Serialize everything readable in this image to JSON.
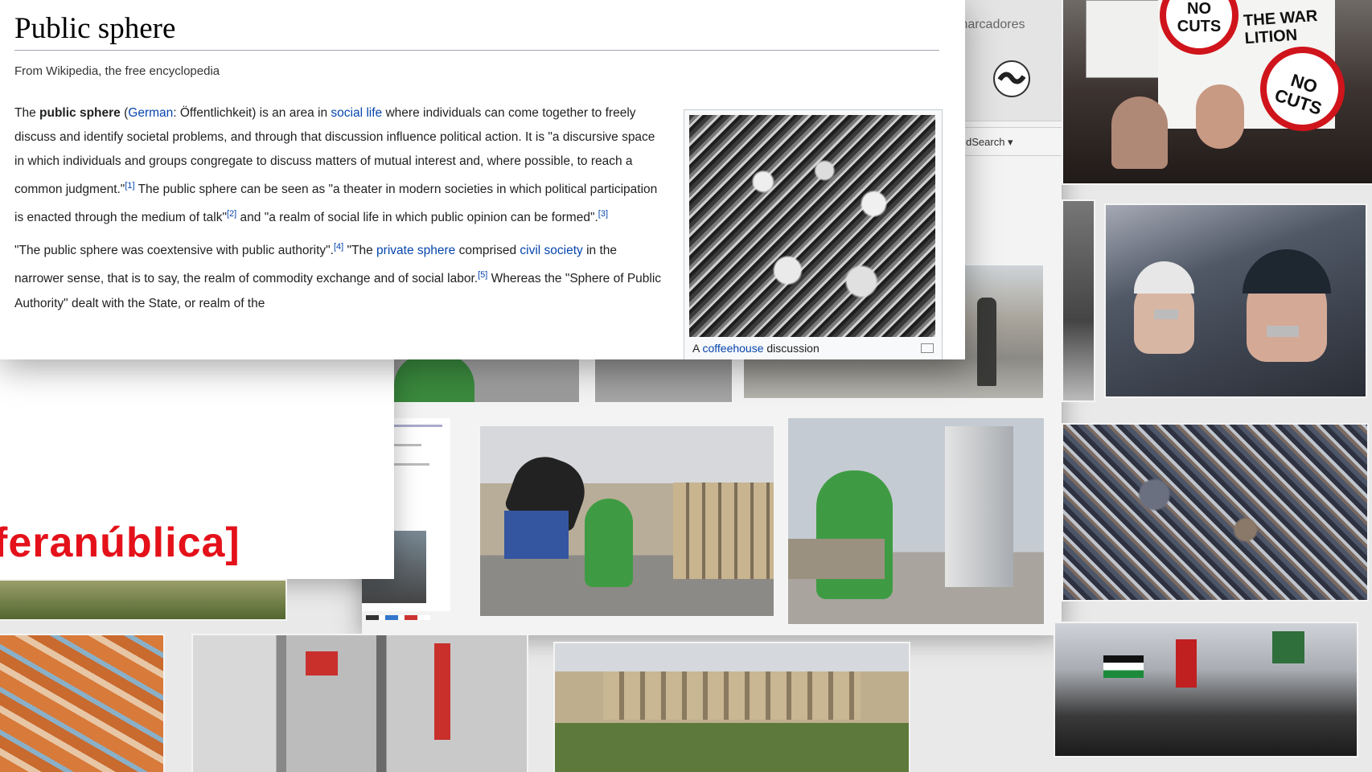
{
  "wiki": {
    "title": "Public sphere",
    "tagline": "From Wikipedia, the free encyclopedia",
    "p1": {
      "t1": "The ",
      "bold": "public sphere",
      "t2": " (",
      "link_german": "German",
      "t3": ": Öffentlichkeit) is an area in ",
      "link_social_life": "social life",
      "t4": " where individuals can come together to freely discuss and identify societal problems, and through that discussion influence political action. It is \"a discursive space in which individuals and groups congregate to discuss matters of mutual interest and, where possible, to reach a common judgment.\"",
      "ref1": "[1]",
      "t5": " The public sphere can be seen as \"a theater in modern societies in which political participation is enacted through the medium of talk\"",
      "ref2": "[2]",
      "t6": " and \"a realm of social life in which public opinion can be formed\".",
      "ref3": "[3]"
    },
    "p2": {
      "t1": "\"The public sphere was coextensive with public authority\".",
      "ref4": "[4]",
      "t2": " \"The ",
      "link_private_sphere": "private sphere",
      "t3": " comprised ",
      "link_civil_society": "civil society",
      "t4": " in the narrower sense, that is to say, the realm of commodity exchange and of social labor.",
      "ref5": "[5]",
      "t5": " Whereas the \"Sphere of Public Authority\" dealt with the State, or realm of the"
    },
    "caption": {
      "prefix": "A ",
      "link": "coffeehouse",
      "suffix": " discussion"
    }
  },
  "back_window": {
    "bookmarks_label": "marcadores",
    "search_label": "dSearch ▾"
  },
  "esfera_logo": "feranública]",
  "protest_signs": {
    "sign_no_cuts_1": "NO CUTS",
    "sign_no_cuts_2": "NO CUTS",
    "banner": "THE WAR\nLITION"
  },
  "colors": {
    "link": "#0645ad",
    "esfera_red": "#e4111a",
    "green_sculpture": "#3f9b43"
  }
}
